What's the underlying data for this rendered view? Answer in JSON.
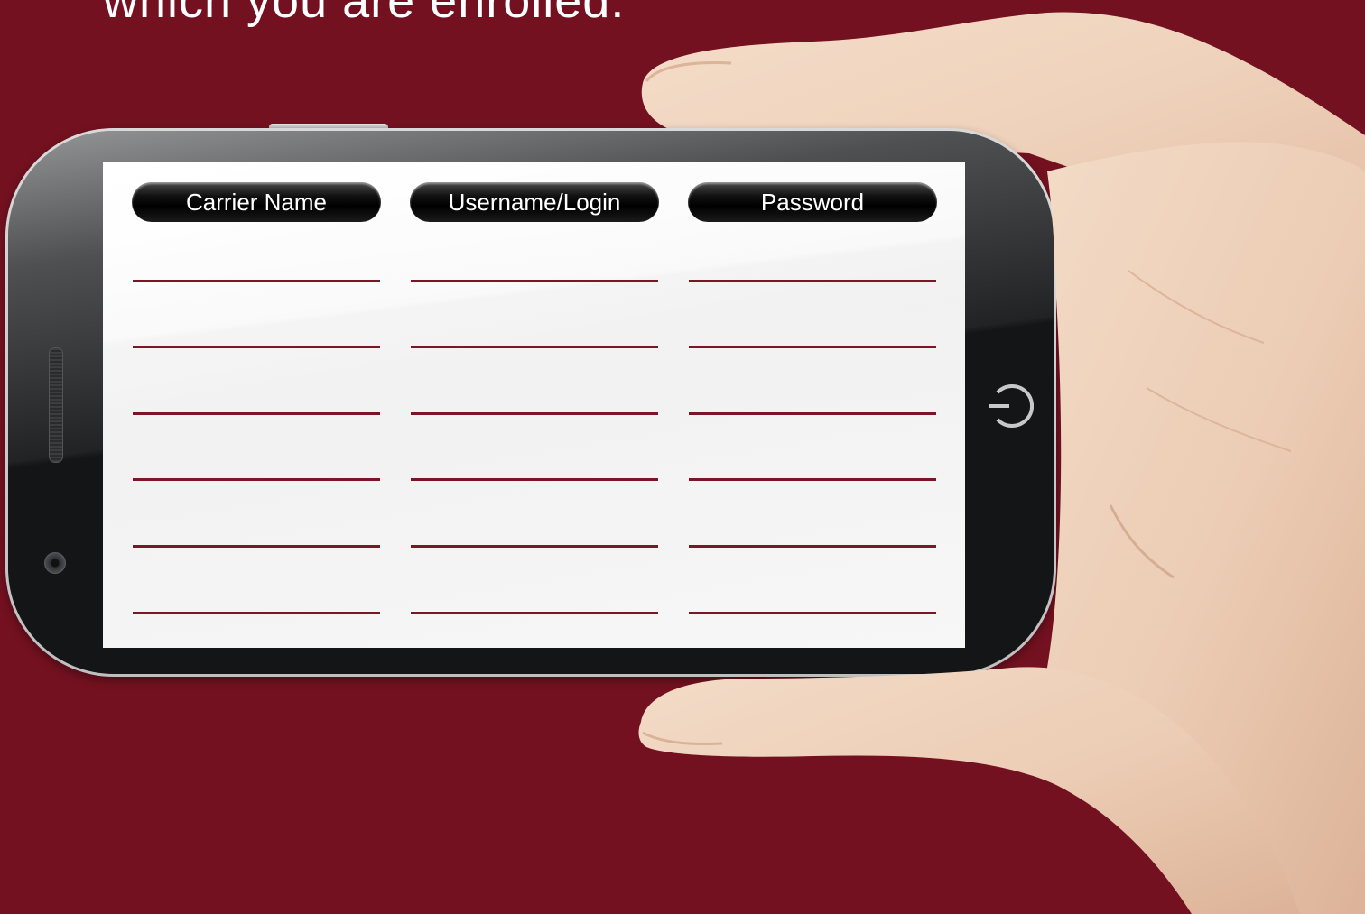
{
  "heading": {
    "text": "which you are enrolled."
  },
  "table": {
    "headers": [
      "Carrier Name",
      "Username/Login",
      "Password"
    ],
    "blank_rows": 6
  },
  "colors": {
    "background": "#731120",
    "line": "#7a1625",
    "screen": "#f5f5f5"
  },
  "icons": {
    "home_button": "power-icon"
  }
}
